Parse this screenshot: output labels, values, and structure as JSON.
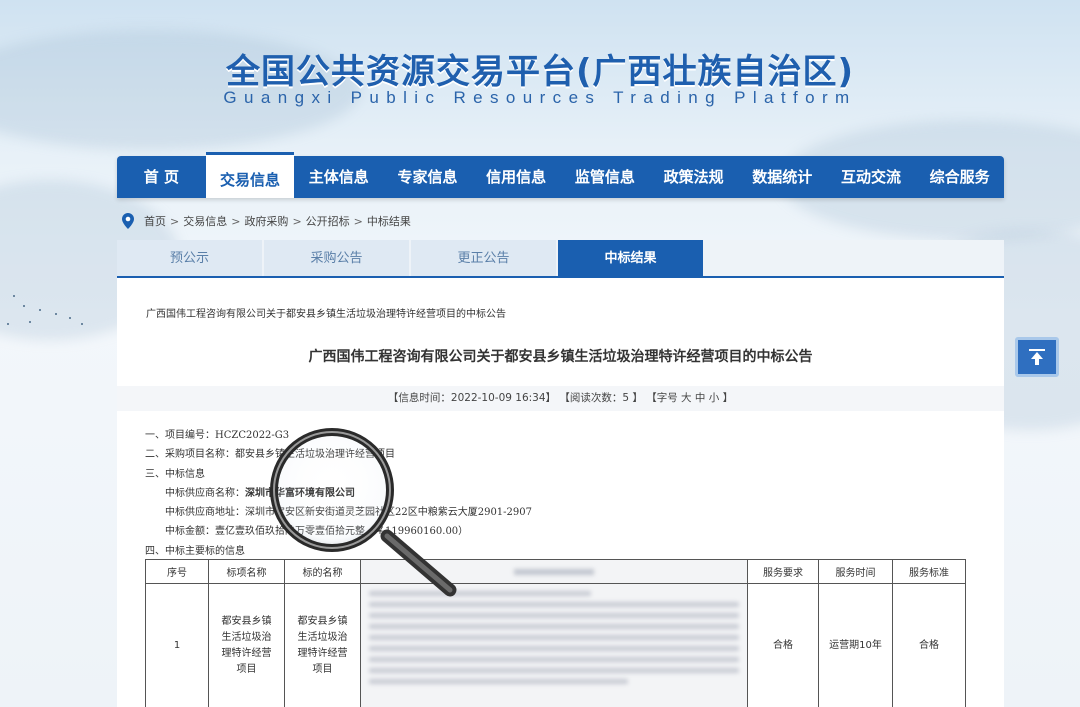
{
  "header": {
    "title": "全国公共资源交易平台(广西壮族自治区)",
    "subtitle": "Guangxi Public Resources Trading Platform"
  },
  "nav": {
    "items": [
      "首 页",
      "交易信息",
      "主体信息",
      "专家信息",
      "信用信息",
      "监管信息",
      "政策法规",
      "数据统计",
      "互动交流",
      "综合服务"
    ]
  },
  "breadcrumb": {
    "items": [
      "首页",
      "交易信息",
      "政府采购",
      "公开招标",
      "中标结果"
    ]
  },
  "tabs": {
    "items": [
      "预公示",
      "采购公告",
      "更正公告",
      "中标结果"
    ]
  },
  "doc": {
    "small_title": "广西国伟工程咨询有限公司关于都安县乡镇生活垃圾治理特许经营项目的中标公告",
    "title": "广西国伟工程咨询有限公司关于都安县乡镇生活垃圾治理特许经营项目的中标公告",
    "meta": "【信息时间：2022-10-09 16:34】 【阅读次数：5 】 【字号 大 中 小 】",
    "lines": {
      "l1": "一、项目编号：HCZC2022-G3",
      "l2a": "二、采购项目名称：都安",
      "l2b": "县乡镇生活垃圾治理",
      "l2c": "许经营项目",
      "l3": "三、中标信息",
      "l4a": "中标供应商名称：",
      "l4b": "深圳市华富环境有限公司",
      "l5a": "中标供应商地址：",
      "l5b": "深圳市宝安区新安街道灵芝园社区22区中粮紫云大厦2901-2907",
      "l6a": "中标金额：壹亿壹",
      "l6b": "玖佰玖拾陆万零壹佰",
      "l6c": "拾元整（￥119960160.00）",
      "l7": "四、中标主要标的信息"
    }
  },
  "table": {
    "headers": [
      "序号",
      "标项名称",
      "标的名称",
      "服务要求",
      "服务时间",
      "服务标准"
    ],
    "row": {
      "index": "1",
      "item_name": "都安县乡镇生活垃圾治理特许经营项目",
      "target_name": "都安县乡镇生活垃圾治理特许经营项目",
      "requirement": "合格",
      "period": "运营期10年",
      "standard": "合格"
    }
  },
  "colors": {
    "brand": "#1a5fb0",
    "title": "#1f5fae"
  },
  "icons": {
    "breadcrumb": "location-pin-icon",
    "back_to_top": "arrow-up-icon",
    "overlay": "magnifier-icon"
  }
}
